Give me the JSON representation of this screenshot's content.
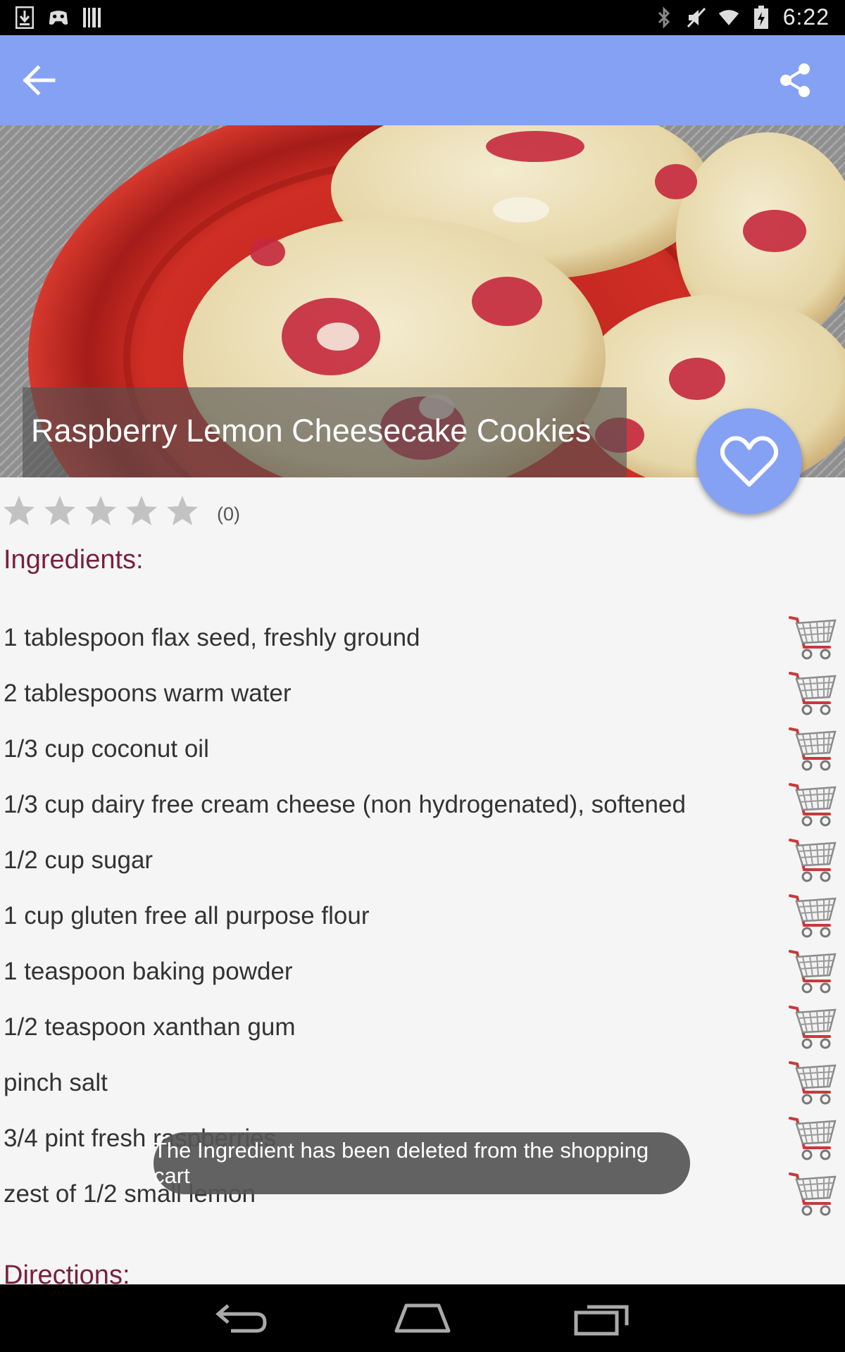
{
  "status_bar": {
    "time": "6:22",
    "left_icons": [
      "download-icon",
      "game-controller-icon",
      "barcode-icon"
    ],
    "right_icons": [
      "bluetooth-icon",
      "mute-icon",
      "wifi-icon",
      "battery-icon"
    ]
  },
  "app_bar": {
    "back_icon": "arrow-back-icon",
    "share_icon": "share-icon"
  },
  "recipe": {
    "title": "Raspberry Lemon Cheesecake Cookies",
    "rating_count": "(0)",
    "stars_filled": 0,
    "stars_total": 5
  },
  "ingredients": {
    "heading": "Ingredients:",
    "items": [
      "1 tablespoon flax seed, freshly ground",
      "2 tablespoons warm water",
      "1/3 cup coconut oil",
      "1/3 cup dairy free cream cheese (non hydrogenated), softened",
      "1/2 cup sugar",
      "1 cup gluten free all purpose flour",
      "1 teaspoon baking powder",
      "1/2 teaspoon xanthan gum",
      "pinch salt",
      "3/4 pint fresh raspberries",
      "zest of 1/2 small lemon"
    ]
  },
  "directions": {
    "heading": "Directions:"
  },
  "toast": {
    "message": "The Ingredient has been deleted from the shopping cart"
  },
  "colors": {
    "app_bar": "#85a1f4",
    "heading": "#7a1f3d",
    "toast_bg": "#555555"
  }
}
